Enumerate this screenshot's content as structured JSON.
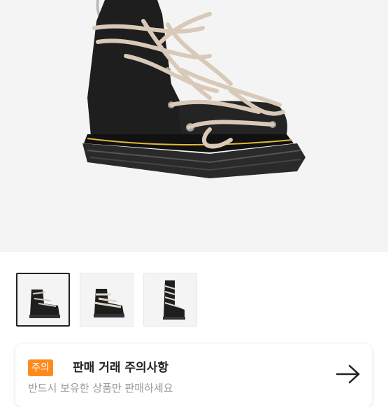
{
  "product": {
    "main_image": "black leather platform boot with long beige laces",
    "thumbnails": [
      {
        "icon": "boot-front-view",
        "selected": true
      },
      {
        "icon": "boot-side-view",
        "selected": false
      },
      {
        "icon": "tall-boot-view",
        "selected": false
      }
    ]
  },
  "notice": {
    "badge": "주의",
    "title": "판매 거래 주의사항",
    "body": "반드시 보유한 상품만 판매하세요",
    "arrow_icon": "arrow-right-icon"
  },
  "colors": {
    "accent": "#ff8a1c",
    "background": "#f4f4f4"
  }
}
